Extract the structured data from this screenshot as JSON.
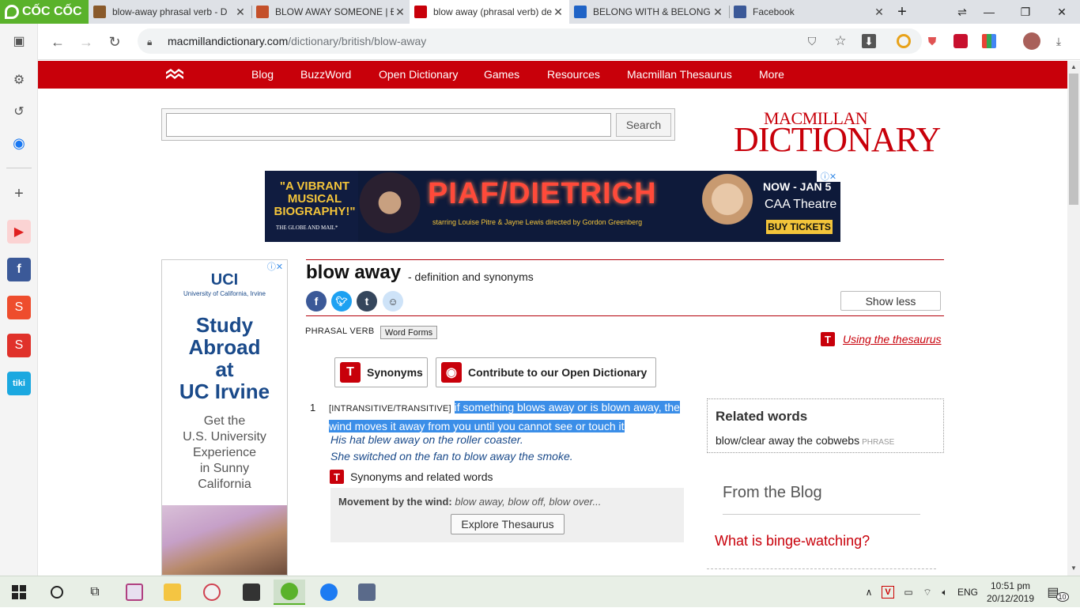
{
  "browser": {
    "brand_label": "CỐC CỐC",
    "tabs": [
      {
        "title": "blow-away phrasal verb - D",
        "favicon_color": "#8a5a2b"
      },
      {
        "title": "BLOW AWAY SOMEONE | Đị",
        "favicon_color": "#c4502a"
      },
      {
        "title": "blow away (phrasal verb) de",
        "favicon_color": "#c8000a"
      },
      {
        "title": "BELONG WITH & BELONG T",
        "favicon_color": "#1f63c6"
      },
      {
        "title": "Facebook",
        "favicon_color": "#3b5998"
      }
    ],
    "new_tab_label": "+",
    "url_host": "macmillandictionary.com",
    "url_path": "/dictionary/british/blow-away",
    "window_controls": {
      "minimize": "—",
      "maximize": "❐",
      "close": "✕"
    }
  },
  "site": {
    "nav": [
      "Blog",
      "BuzzWord",
      "Open Dictionary",
      "Games",
      "Resources",
      "Macmillan Thesaurus",
      "More"
    ],
    "search_placeholder": "",
    "search_button": "Search",
    "logo_top": "MACMILLAN",
    "logo_bottom": "DICTIONARY"
  },
  "banner_ad": {
    "quote": "\"A VIBRANT MUSICAL BIOGRAPHY!\"",
    "quote_source": "THE GLOBE AND MAIL*",
    "title": "PIAF/DIETRICH",
    "credits": "starring Louise Pitre & Jayne Lewis   directed by Gordon Greenberg",
    "dates": "NOW - JAN 5",
    "venue": "CAA Theatre",
    "cta": "BUY TICKETS"
  },
  "side_ad": {
    "org": "UCI",
    "org_full": "University of California, Irvine",
    "headline": [
      "Study",
      "Abroad",
      "at",
      "UC Irvine"
    ],
    "body": [
      "Get the",
      "U.S. University",
      "Experience",
      "in Sunny",
      "California"
    ]
  },
  "entry": {
    "headword": "blow away",
    "subtitle": "- definition and synonyms",
    "show_less": "Show less",
    "part_of_speech": "PHRASAL VERB",
    "word_forms": "Word Forms",
    "using_thesaurus": "Using the thesaurus",
    "synonyms_button": "Synonyms",
    "contribute_button": "Contribute to our Open Dictionary",
    "sense_number": "1",
    "grammar": "[INTRANSITIVE/TRANSITIVE]",
    "definition": " if something blows away or is blown away, the wind moves it away from you until you cannot see or touch it",
    "examples": [
      "His hat blew away on the roller coaster.",
      "She switched on the fan to blow away the smoke."
    ],
    "syn_related_label": "Synonyms and related words",
    "thesaurus_label": "Movement by the wind:",
    "thesaurus_words": "blow away, blow off, blow over...",
    "explore_button": "Explore Thesaurus"
  },
  "related": {
    "heading": "Related words",
    "item": "blow/clear away the cobwebs",
    "item_tag": "PHRASE"
  },
  "blog": {
    "heading": "From the Blog",
    "link": "What is binge-watching?"
  },
  "taskbar": {
    "language": "ENG",
    "time": "10:51 pm",
    "date": "20/12/2019",
    "notifications": "10"
  }
}
